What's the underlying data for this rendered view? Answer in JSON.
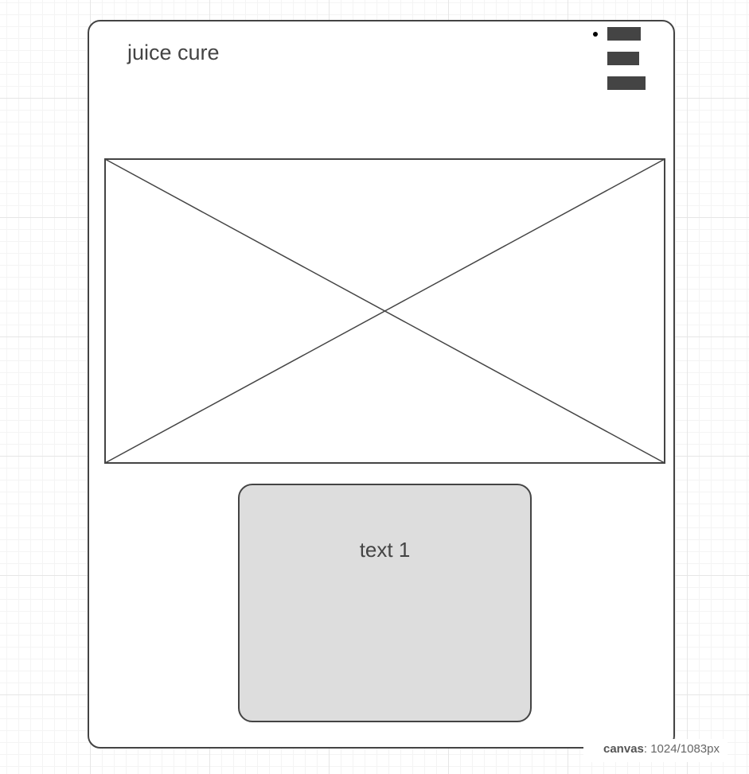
{
  "wireframe": {
    "title": "juice cure",
    "card": {
      "label": "text 1"
    }
  },
  "canvas_info": {
    "key": "canvas",
    "separator": ": ",
    "value": "1024/1083px"
  },
  "colors": {
    "stroke": "#444444",
    "card_fill": "#dddddd",
    "background": "#ffffff",
    "grid_line": "#e6e6e6"
  },
  "icons": {
    "menu": "hamburger-menu-icon",
    "image": "image-placeholder-icon"
  }
}
